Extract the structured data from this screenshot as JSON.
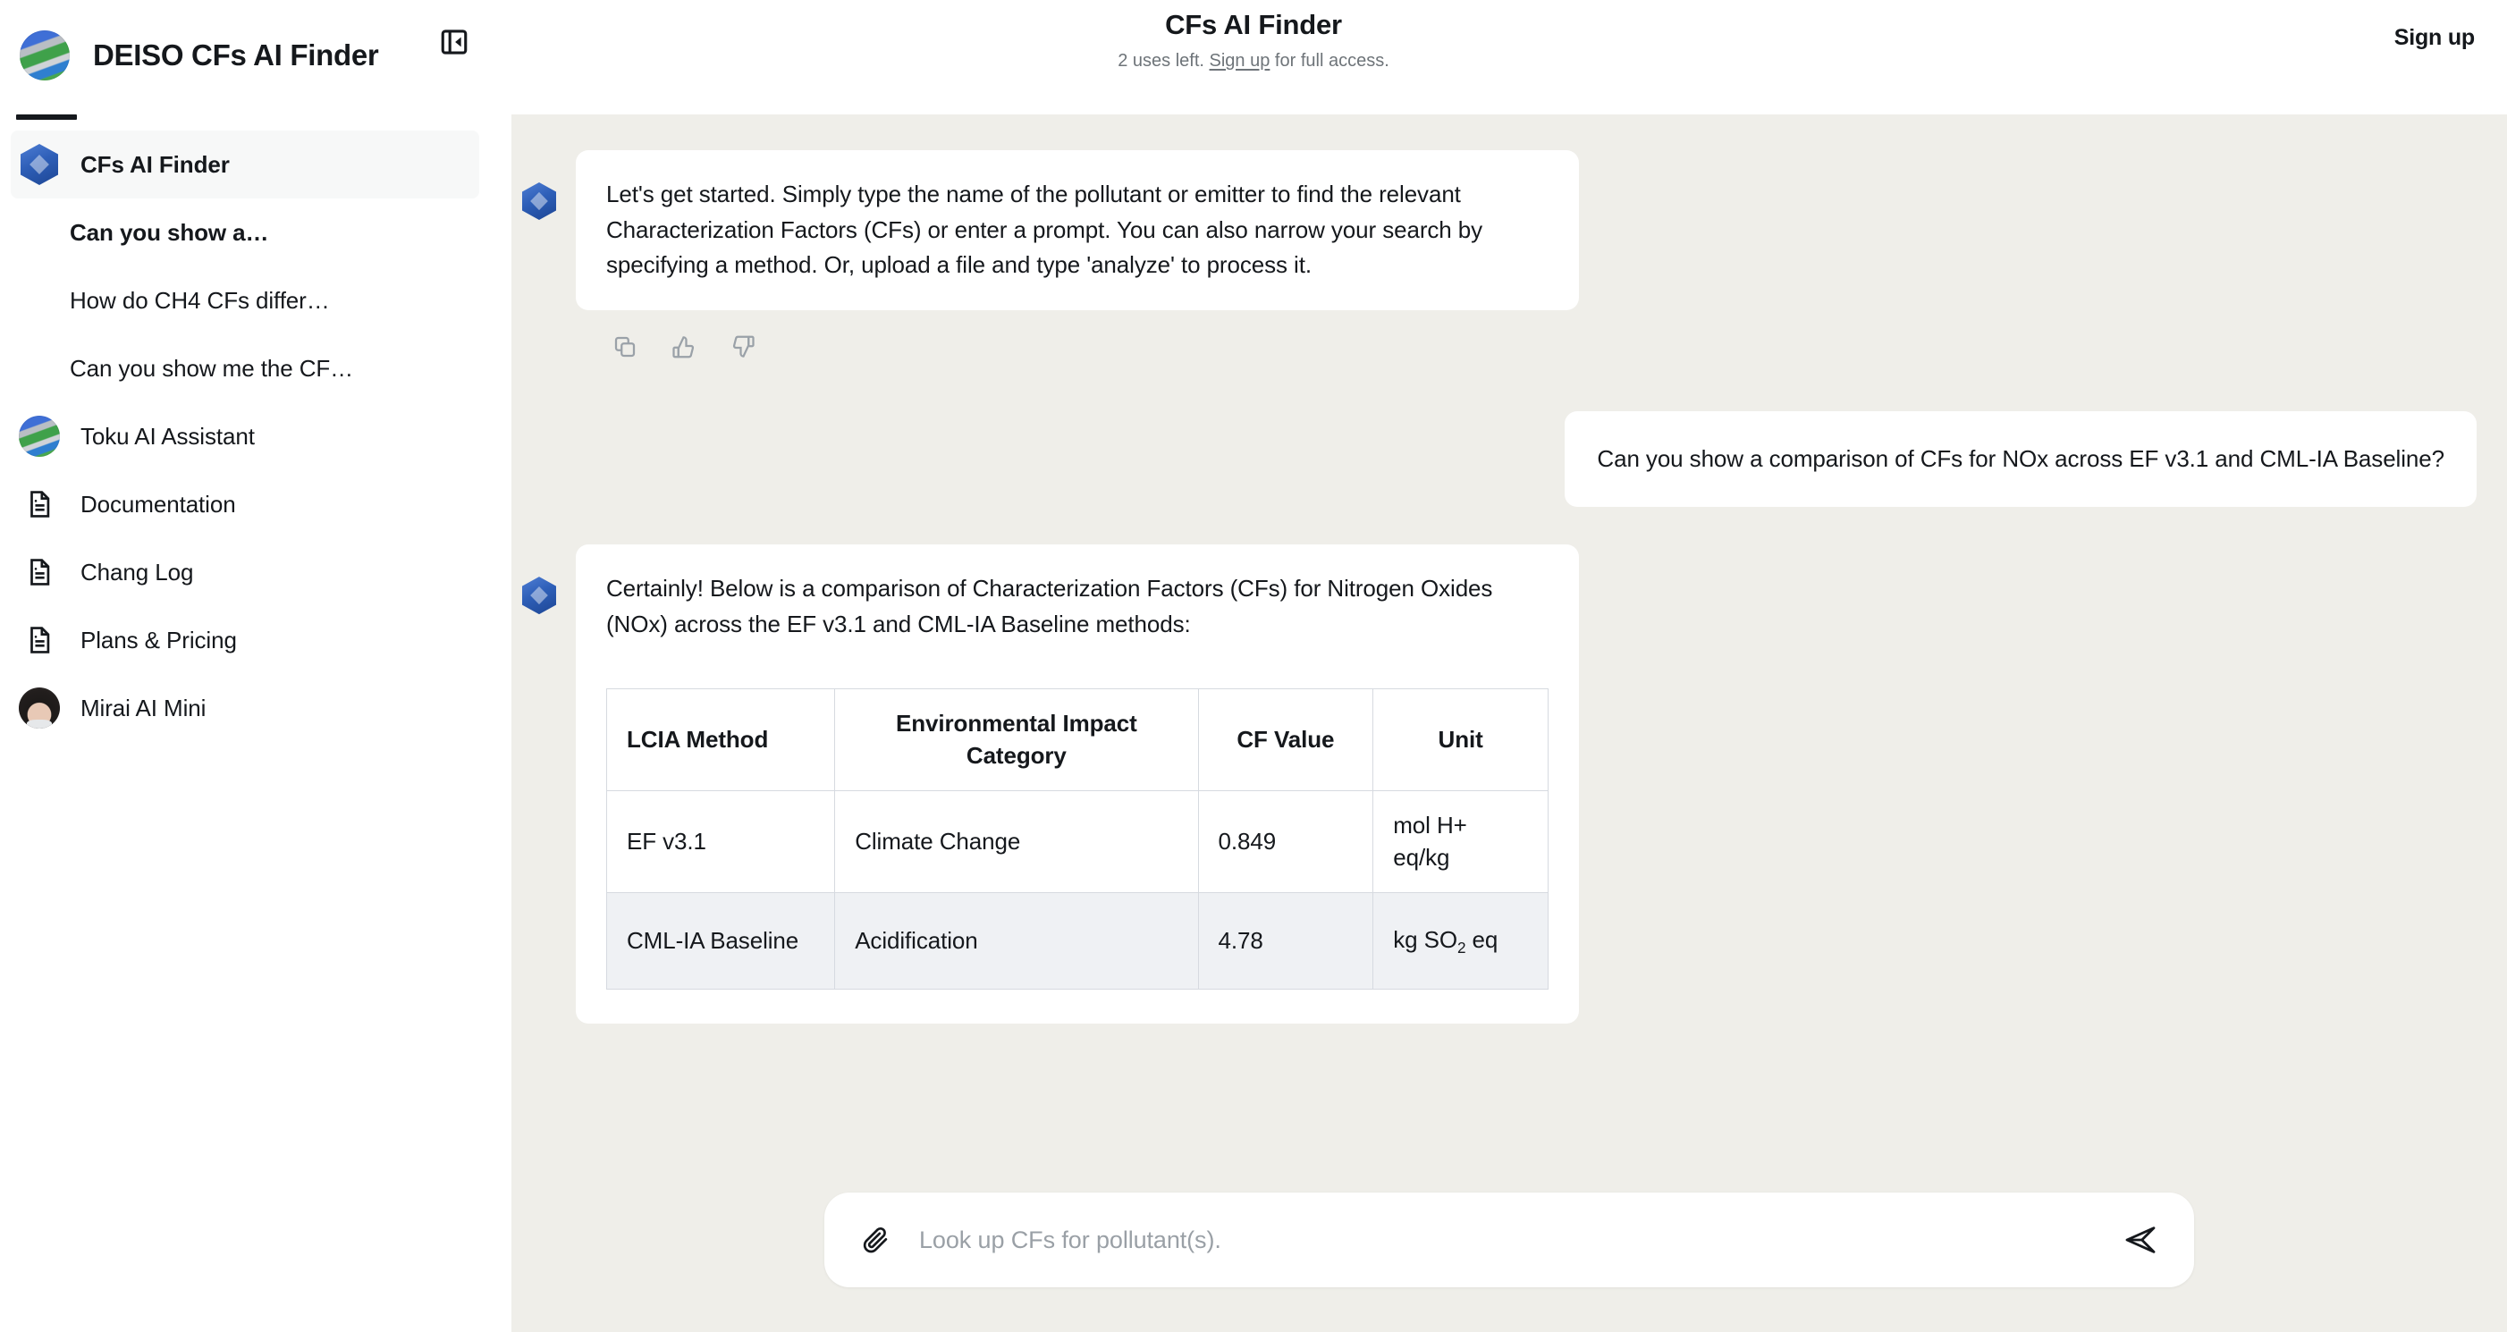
{
  "header": {
    "brand_title": "DEISO CFs AI Finder",
    "app_title": "CFs AI Finder",
    "uses_prefix": "2 uses left.",
    "signup_link": "Sign up",
    "uses_suffix": "for full access.",
    "signup_button": "Sign up",
    "sidebar_toggle_icon": "panel-collapse-icon",
    "logo_icon": "deiso-globe-logo"
  },
  "sidebar": {
    "items": [
      {
        "label": "CFs AI Finder",
        "icon": "hex-blue-logo-icon",
        "selected": true,
        "bold": true
      },
      {
        "label": "Can you show a…",
        "icon": "none",
        "selected": false,
        "bold": true
      },
      {
        "label": "How do CH4 CFs differ…",
        "icon": "none",
        "selected": false,
        "bold": false
      },
      {
        "label": "Can you show me the CF…",
        "icon": "none",
        "selected": false,
        "bold": false
      },
      {
        "label": "Toku AI Assistant",
        "icon": "deiso-globe-logo-icon",
        "selected": false,
        "bold": false
      },
      {
        "label": "Documentation",
        "icon": "document-icon",
        "selected": false,
        "bold": false
      },
      {
        "label": "Chang Log",
        "icon": "document-icon",
        "selected": false,
        "bold": false
      },
      {
        "label": "Plans & Pricing",
        "icon": "document-icon",
        "selected": false,
        "bold": false
      },
      {
        "label": "Mirai AI Mini",
        "icon": "avatar-photo-icon",
        "selected": false,
        "bold": false
      }
    ]
  },
  "chat": {
    "assistant_intro": "Let's get started. Simply type the name of the pollutant or emitter to find the relevant Characterization Factors (CFs) or enter a prompt. You can also narrow your search by specifying a method. Or, upload a file and type 'analyze' to process it.",
    "actions": {
      "copy": "copy-icon",
      "thumbs_up": "thumbs-up-icon",
      "thumbs_down": "thumbs-down-icon"
    },
    "user_message": "Can you show a comparison of CFs for NOx across EF v3.1 and CML-IA Baseline?",
    "assistant_answer": "Certainly! Below is a comparison of Characterization Factors (CFs) for Nitrogen Oxides (NOx) across the EF v3.1 and CML-IA Baseline methods:",
    "table": {
      "headers": [
        "LCIA Method",
        "Environmental Impact Category",
        "CF Value",
        "Unit"
      ],
      "rows": [
        {
          "method": "EF v3.1",
          "category": "Climate Change",
          "cf_value": "0.849",
          "unit_text": "mol H+ eq/kg",
          "unit_html": "mol H+ eq/kg"
        },
        {
          "method": "CML-IA Baseline",
          "category": "Acidification",
          "cf_value": "4.78",
          "unit_text": "kg SO2 eq",
          "unit_html": "kg SO<sub>2</sub> eq"
        }
      ]
    }
  },
  "composer": {
    "placeholder": "Look up CFs for pollutant(s).",
    "attach_icon": "paperclip-icon",
    "send_icon": "send-paper-plane-icon"
  },
  "colors": {
    "chat_background": "#EFEEE9",
    "sidebar_background": "#FFFFFF",
    "bubble_background": "#FFFFFF",
    "text_primary": "#15181C",
    "text_muted": "#6E7479",
    "table_border": "#D6DAE0",
    "table_alt_row": "#EFF1F4",
    "brand_blue": "#2E5FB8"
  }
}
